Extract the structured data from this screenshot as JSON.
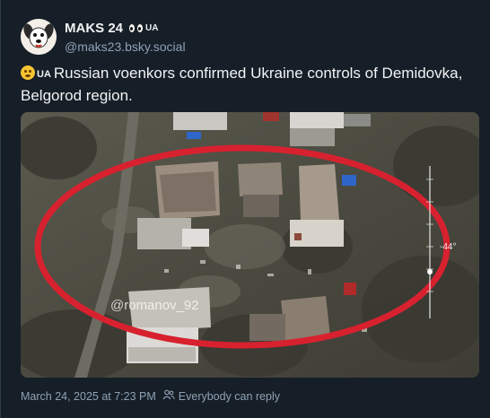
{
  "author": {
    "display_name": "MAKS 24",
    "badge_text": "UA",
    "handle": "@maks23.bsky.social",
    "avatar_icon": "dog-avatar-icon"
  },
  "post": {
    "emoji_icon": "smiling-face-icon",
    "ua_tag": "UA",
    "text": "Russian voenkors confirmed Ukraine controls of Demidovka, Belgorod region."
  },
  "media": {
    "watermark": "@romanov_92",
    "altitude_label": "-44°",
    "highlight_color": "#d8212f"
  },
  "footer": {
    "timestamp": "March 24, 2025 at 7:23 PM",
    "reply_setting": "Everybody can reply"
  },
  "colors": {
    "background": "#161e27",
    "text_primary": "#f1f3f5",
    "text_secondary": "#8fa2b5"
  }
}
